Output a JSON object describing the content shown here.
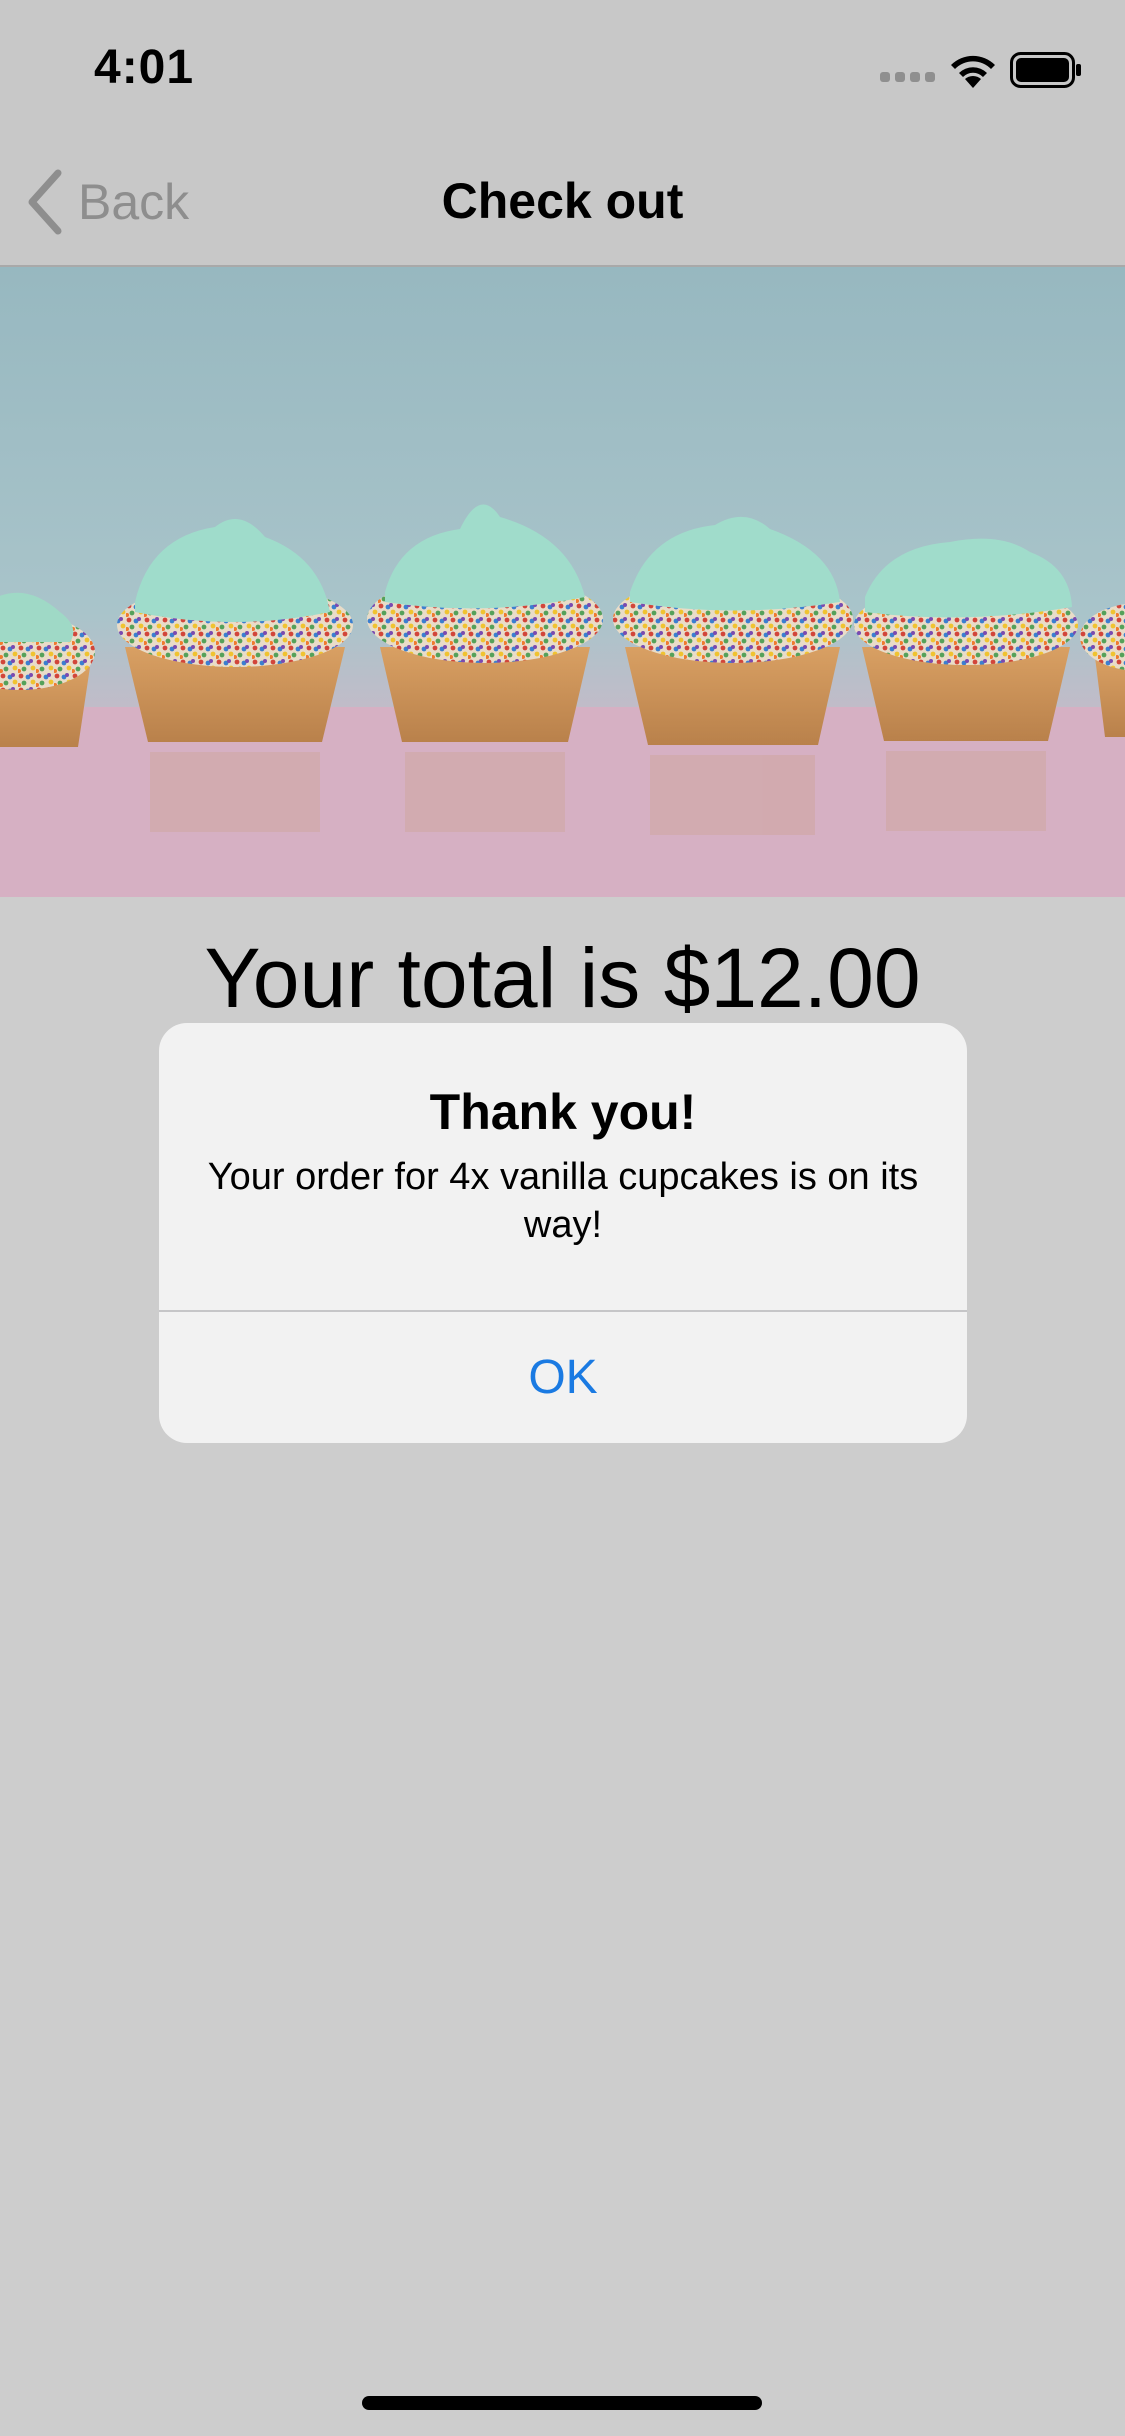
{
  "status_bar": {
    "time": "4:01"
  },
  "nav": {
    "back_label": "Back",
    "title": "Check out"
  },
  "hero": {
    "alt": "Cupcakes with mint frosting and sprinkles"
  },
  "order": {
    "total_text": "Your total is $12.00"
  },
  "alert": {
    "title": "Thank you!",
    "message": "Your order for 4x vanilla cupcakes is on its way!",
    "ok_label": "OK"
  },
  "colors": {
    "accent": "#1a7ae2",
    "background": "#cdcdcd",
    "alert_bg": "#f2f2f2"
  }
}
